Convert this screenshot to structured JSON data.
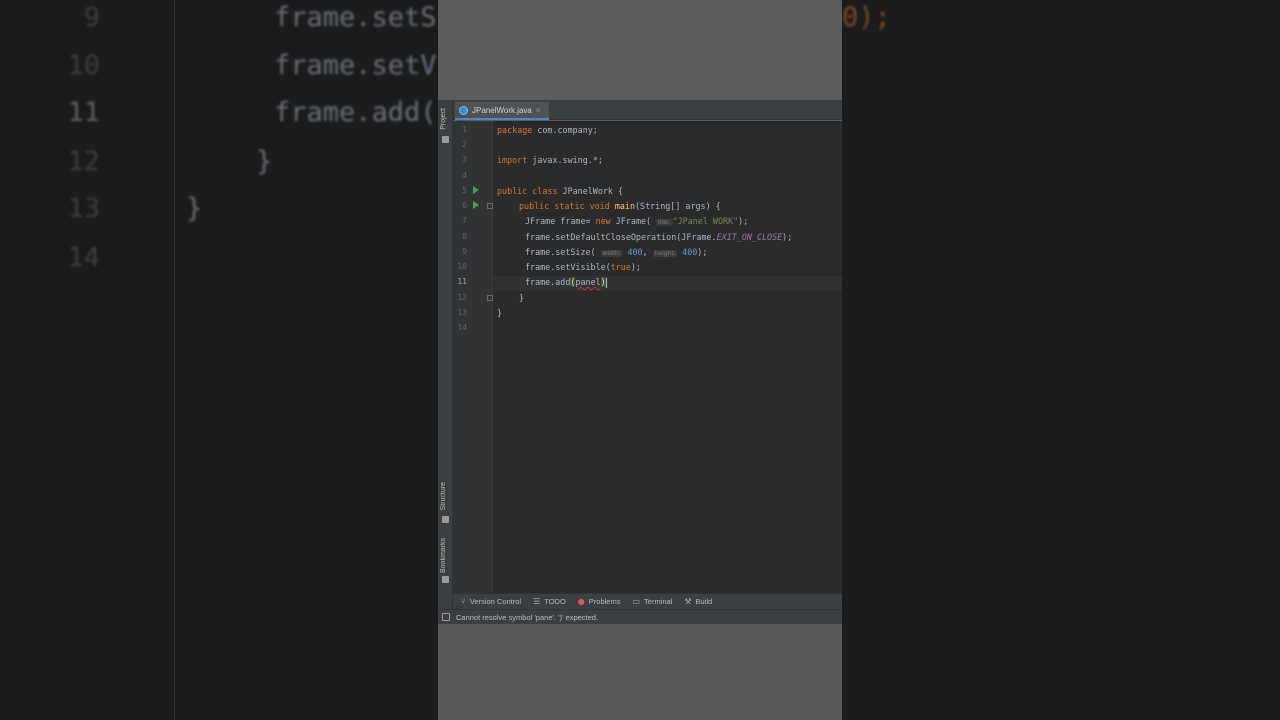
{
  "background": {
    "line_numbers": [
      "9",
      "10",
      "11",
      "12",
      "13",
      "14"
    ],
    "current_line": "11",
    "lines": [
      "frame.setS",
      "frame.setV",
      "frame.add(",
      "}",
      "}"
    ],
    "right_fragment": "0);"
  },
  "sidebar": {
    "project_label": "Project",
    "structure_label": "Structure",
    "bookmarks_label": "Bookmarks"
  },
  "editor": {
    "tab": {
      "label": "JPanelWork.java",
      "close": "×"
    },
    "line_numbers": [
      "1",
      "2",
      "3",
      "4",
      "5",
      "6",
      "7",
      "8",
      "9",
      "10",
      "11",
      "12",
      "13",
      "14"
    ],
    "current_line": "11",
    "code": {
      "l1_kw": "package",
      "l1_rest": " com.company;",
      "l3_kw": "import",
      "l3_rest": " javax.swing.*;",
      "l5_kw": "public class",
      "l5_rest": " JPanelWork {",
      "l6_kw": "public static void",
      "l6_fn": "main",
      "l6_rest": "(String[] args) {",
      "l7_a": "JFrame frame= ",
      "l7_kw": "new",
      "l7_b": " JFrame(",
      "l7_hint": "title:",
      "l7_str": "\"JPanel WORK\"",
      "l7_c": ");",
      "l8_a": "frame.setDefaultCloseOperation(JFrame.",
      "l8_const": "EXIT_ON_CLOSE",
      "l8_b": ");",
      "l9_a": "frame.setSize(",
      "l9_hint1": "width:",
      "l9_num1": "400",
      "l9_sep": ", ",
      "l9_hint2": "height:",
      "l9_num2": "400",
      "l9_b": ");",
      "l10_a": "frame.setVisible(",
      "l10_kw": "true",
      "l10_b": ");",
      "l11_a": "frame.add",
      "l11_open": "(",
      "l11_arg": "panel",
      "l11_close": ")",
      "l12": "}",
      "l13": "}"
    }
  },
  "tool_windows": {
    "version_control": "Version Control",
    "todo": "TODO",
    "problems": "Problems",
    "terminal": "Terminal",
    "build": "Build"
  },
  "status": {
    "message": "Cannot resolve symbol 'pane'. ')' expected."
  },
  "colors": {
    "keyword": "#cc7832",
    "string": "#6a8759",
    "number": "#6897bb",
    "function": "#ffc66d",
    "constant": "#9876aa",
    "run_icon": "#499c54"
  }
}
